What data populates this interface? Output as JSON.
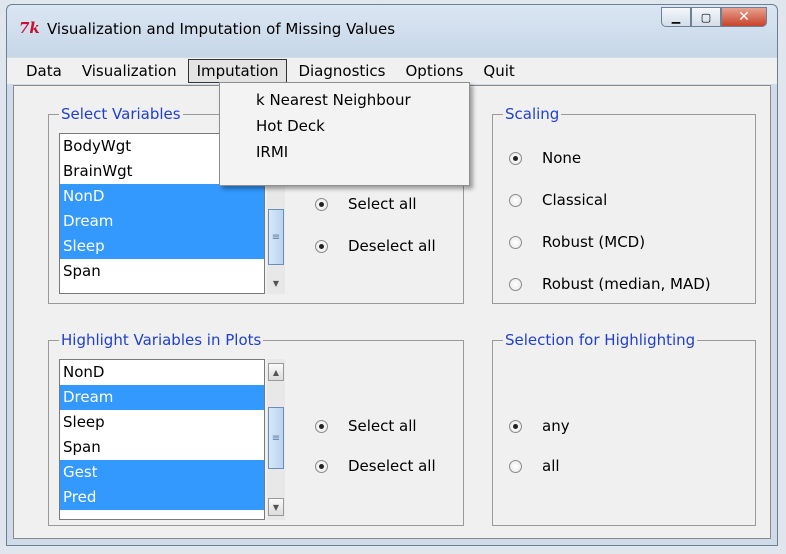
{
  "window": {
    "title": "Visualization and Imputation of Missing Values",
    "logo": "7k"
  },
  "menubar": {
    "items": [
      "Data",
      "Visualization",
      "Imputation",
      "Diagnostics",
      "Options",
      "Quit"
    ],
    "active": "Imputation"
  },
  "imputation_menu": {
    "items": [
      "k Nearest Neighbour",
      "Hot Deck",
      "IRMI"
    ]
  },
  "select_variables": {
    "title": "Select Variables",
    "items": [
      {
        "label": "BodyWgt",
        "selected": false
      },
      {
        "label": "BrainWgt",
        "selected": false
      },
      {
        "label": "NonD",
        "selected": true
      },
      {
        "label": "Dream",
        "selected": true
      },
      {
        "label": "Sleep",
        "selected": true
      },
      {
        "label": "Span",
        "selected": false
      }
    ],
    "select_all": "Select all",
    "deselect_all": "Deselect all"
  },
  "scaling": {
    "title": "Scaling",
    "options": [
      "None",
      "Classical",
      "Robust (MCD)",
      "Robust (median, MAD)"
    ],
    "selected": "None"
  },
  "highlight_variables": {
    "title": "Highlight Variables in Plots",
    "items": [
      {
        "label": "NonD",
        "selected": false
      },
      {
        "label": "Dream",
        "selected": true
      },
      {
        "label": "Sleep",
        "selected": false
      },
      {
        "label": "Span",
        "selected": false
      },
      {
        "label": "Gest",
        "selected": true
      },
      {
        "label": "Pred",
        "selected": true
      }
    ],
    "select_all": "Select all",
    "deselect_all": "Deselect all"
  },
  "selection_highlighting": {
    "title": "Selection for Highlighting",
    "options": [
      "any",
      "all"
    ],
    "selected": "any"
  },
  "colors": {
    "selection": "#3399ff",
    "group_title": "#1f3fd0",
    "close_button": "#c7432a"
  }
}
